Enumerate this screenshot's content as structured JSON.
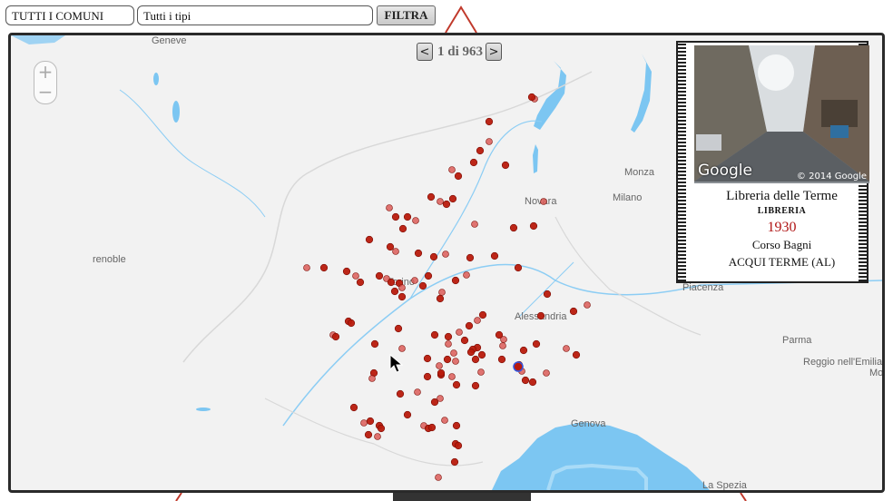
{
  "filters": {
    "comune": "TUTTI I COMUNI",
    "tipi": "Tutti i tipi",
    "filtra_label": "FILTRA"
  },
  "pager": {
    "prev": "<",
    "next": ">",
    "count_text": "1 di 963"
  },
  "zoom": {
    "plus": "+",
    "minus": "−"
  },
  "map_labels": [
    {
      "name": "geneve",
      "text": "Geneve"
    },
    {
      "name": "grenoble",
      "text": "renoble"
    },
    {
      "name": "monza",
      "text": "Monza"
    },
    {
      "name": "milano",
      "text": "Milano"
    },
    {
      "name": "novara",
      "text": "Novara"
    },
    {
      "name": "torino",
      "text": "Torino"
    },
    {
      "name": "alessandria",
      "text": "Alessandria"
    },
    {
      "name": "piacenza",
      "text": "Piacenza"
    },
    {
      "name": "parma",
      "text": "Parma"
    },
    {
      "name": "reggio",
      "text": "Reggio nell'Emilia"
    },
    {
      "name": "modena",
      "text": "Mo"
    },
    {
      "name": "genova",
      "text": "Genova"
    },
    {
      "name": "la-spezia",
      "text": "La Spezia"
    }
  ],
  "card": {
    "photo_brand": "Google",
    "photo_copyright": "© 2014 Google",
    "name": "Libreria delle Terme",
    "category": "LIBRERIA",
    "year": "1930",
    "address": "Corso Bagni",
    "city": "ACQUI TERME (AL)"
  },
  "colors": {
    "marker": "#b81a0c",
    "marker_light": "#d9534f",
    "selected_ring": "#3355dd",
    "water": "#7cc6f2",
    "land": "#f2f2f2",
    "frame": "#c0392b"
  }
}
